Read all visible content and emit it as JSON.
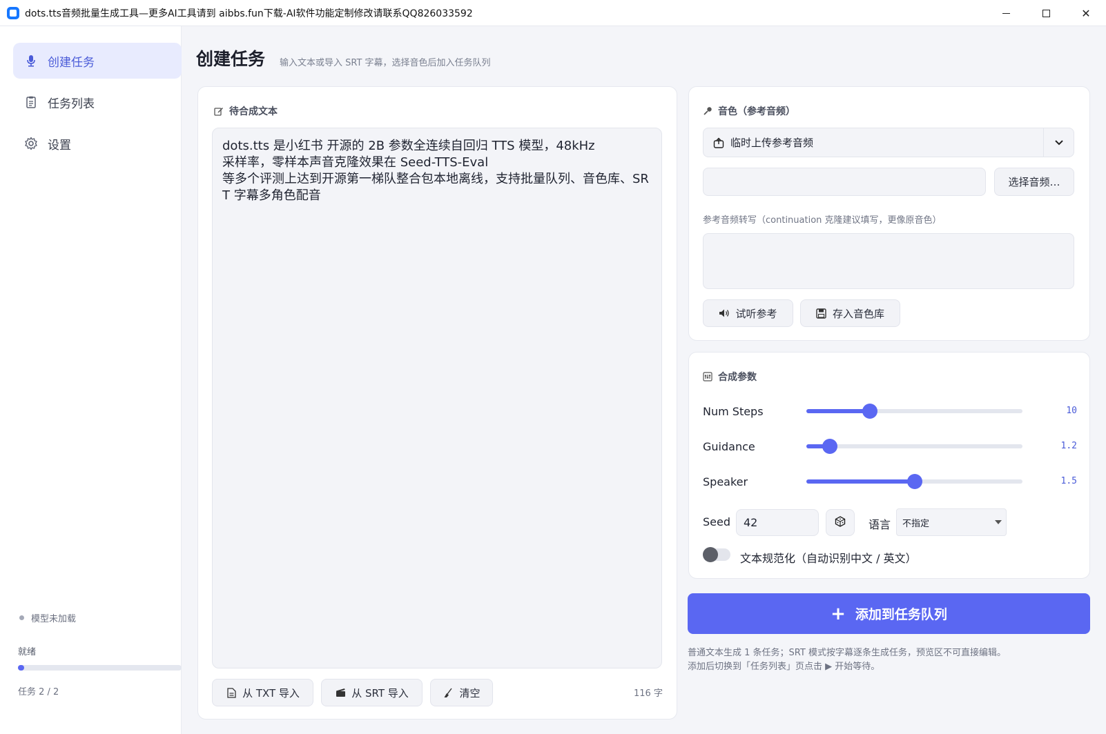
{
  "window": {
    "title": "dots.tts音频批量生成工具—更多AI工具请到 aibbs.fun下载-AI软件功能定制修改请联系QQ826033592"
  },
  "sidebar": {
    "items": [
      {
        "label": "创建任务",
        "icon": "microphone-icon",
        "active": true
      },
      {
        "label": "任务列表",
        "icon": "clipboard-icon",
        "active": false
      },
      {
        "label": "设置",
        "icon": "gear-icon",
        "active": false
      }
    ],
    "model_status": "模型未加载",
    "ready_text": "就绪",
    "progress": 0.02,
    "task_count": "任务 2 / 2"
  },
  "header": {
    "title": "创建任务",
    "subtitle": "输入文本或导入 SRT 字幕，选择音色后加入任务队列"
  },
  "text_panel": {
    "label": "待合成文本",
    "content": "dots.tts 是小红书 开源的 2B 参数全连续自回归 TTS 模型，48kHz\n采样率，零样本声音克隆效果在 Seed-TTS-Eval\n等多个评测上达到开源第一梯队整合包本地离线，支持批量队列、音色库、SRT 字幕多角色配音",
    "import_txt": "从 TXT 导入",
    "import_srt": "从 SRT 导入",
    "clear": "清空",
    "char_count": "116 字"
  },
  "voice_panel": {
    "label": "音色（参考音频）",
    "select_value": "临时上传参考音频",
    "file_path": "",
    "choose_button": "选择音频…",
    "transcript_label": "参考音频转写（continuation 克隆建议填写，更像原音色）",
    "transcript_value": "",
    "preview_button": "试听参考",
    "save_button": "存入音色库"
  },
  "params_panel": {
    "label": "合成参数",
    "sliders": [
      {
        "label": "Num Steps",
        "value": "10",
        "fraction": 0.295
      },
      {
        "label": "Guidance",
        "value": "1.2",
        "fraction": 0.11
      },
      {
        "label": "Speaker",
        "value": "1.5",
        "fraction": 0.5
      }
    ],
    "seed_label": "Seed",
    "seed_value": "42",
    "lang_label": "语言",
    "lang_value": "不指定",
    "normalize_label": "文本规范化（自动识别中文 / 英文）",
    "normalize_on": false
  },
  "actions": {
    "add_button": "添加到任务队列",
    "note_line1": "普通文本生成 1 条任务；SRT 模式按字幕逐条生成任务，预览区不可直接编辑。",
    "note_line2": "添加后切换到「任务列表」页点击 ▶ 开始等待。"
  },
  "colors": {
    "accent": "#5a67f2",
    "active_nav_bg": "#e8ebfe"
  }
}
